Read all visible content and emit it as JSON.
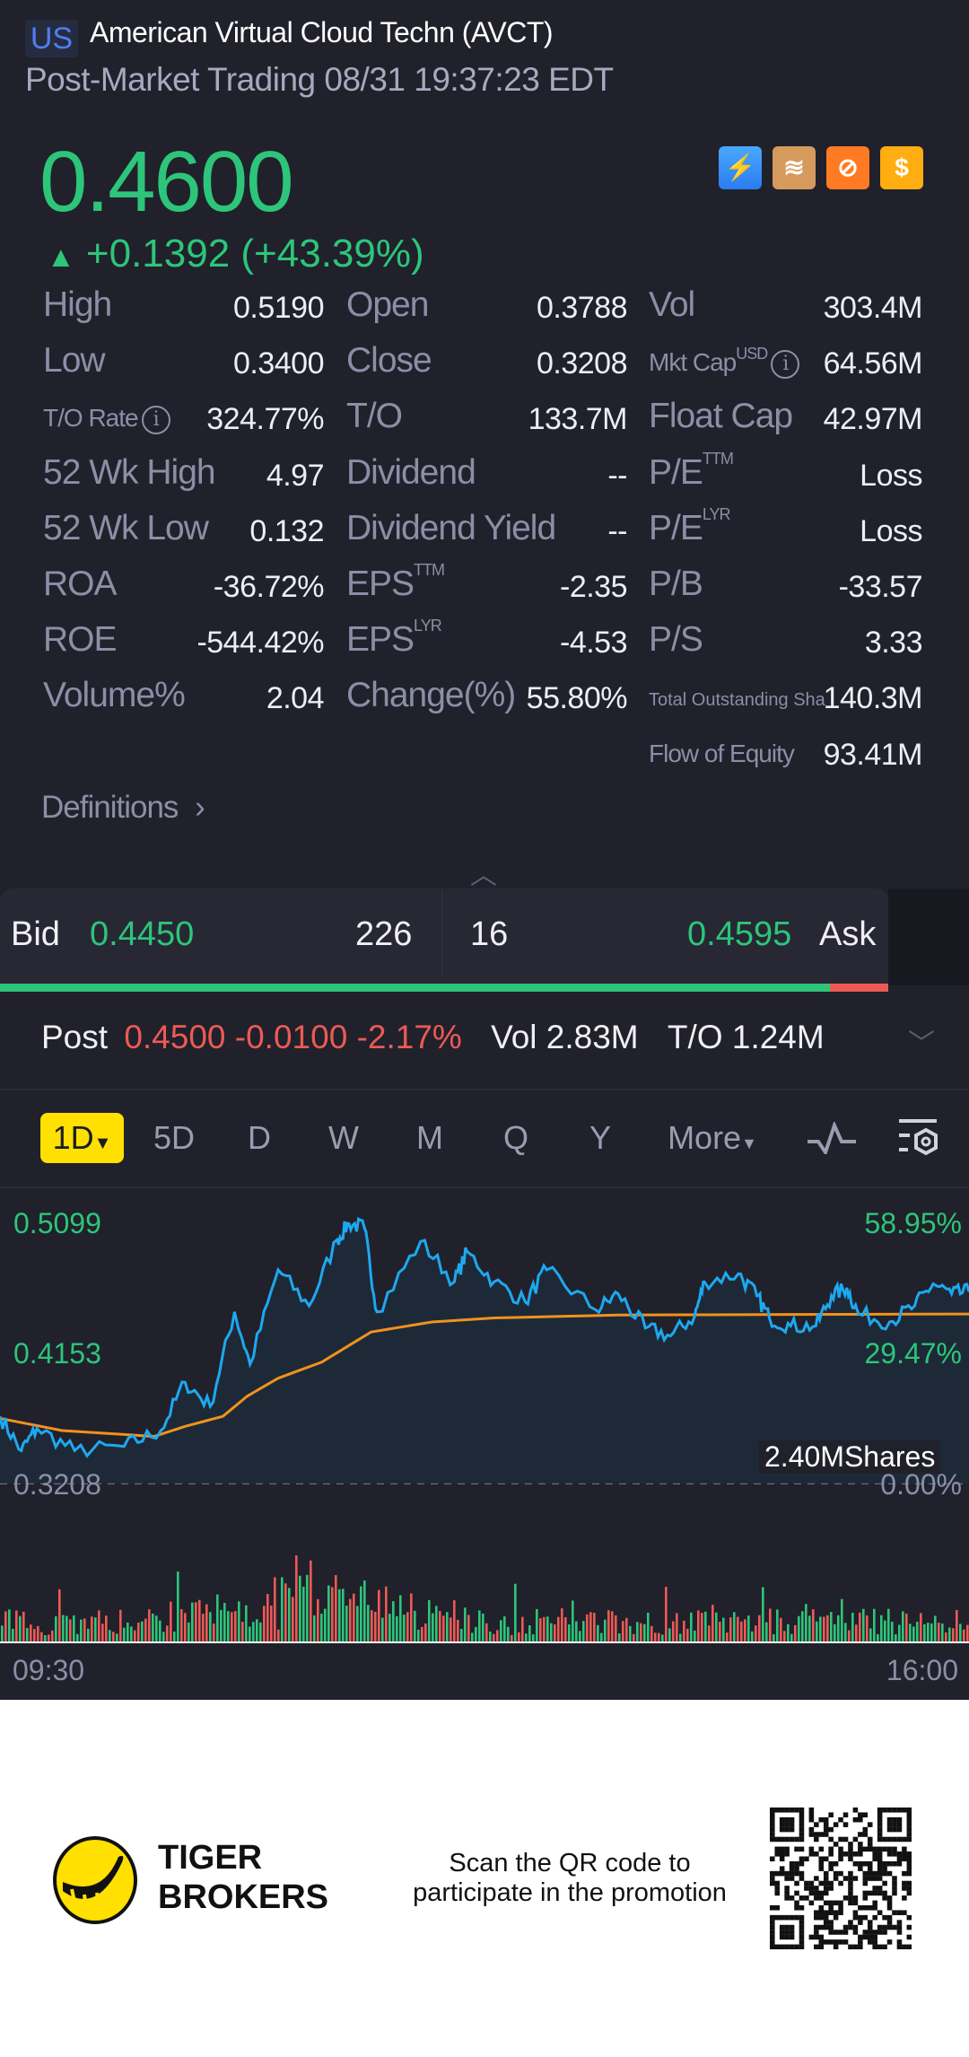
{
  "header": {
    "market": "US",
    "title": "American Virtual Cloud Techn (AVCT)",
    "subtitle": "Post-Market Trading 08/31 19:37:23 EDT"
  },
  "quote": {
    "price": "0.4600",
    "change": "+0.1392 (+43.39%)",
    "arrow": "▲"
  },
  "badges": [
    {
      "icon": "lightning-level1-icon",
      "text": "⚡"
    },
    {
      "icon": "layers-a-icon",
      "text": "≋"
    },
    {
      "icon": "no-short-icon",
      "text": "⊘"
    },
    {
      "icon": "dollar-icon",
      "text": "$"
    }
  ],
  "stats": [
    [
      {
        "label": "High",
        "value": "0.5190"
      },
      {
        "label": "Open",
        "value": "0.3788"
      },
      {
        "label": "Vol",
        "value": "303.4M"
      }
    ],
    [
      {
        "label": "Low",
        "value": "0.3400"
      },
      {
        "label": "Close",
        "value": "0.3208"
      },
      {
        "label": "Mkt Cap",
        "sup": "USD",
        "value": "64.56M"
      }
    ],
    [
      {
        "label": "T/O Rate",
        "value": "324.77%"
      },
      {
        "label": "T/O",
        "value": "133.7M"
      },
      {
        "label": "Float Cap",
        "value": "42.97M"
      }
    ],
    [
      {
        "label": "52 Wk High",
        "value": "4.97"
      },
      {
        "label": "Dividend",
        "value": "--"
      },
      {
        "label": "P/E",
        "sup": "TTM",
        "value": "Loss"
      }
    ],
    [
      {
        "label": "52 Wk Low",
        "value": "0.132"
      },
      {
        "label": "Dividend Yield",
        "value": "--"
      },
      {
        "label": "P/E",
        "sup": "LYR",
        "value": "Loss"
      }
    ],
    [
      {
        "label": "ROA",
        "value": "-36.72%"
      },
      {
        "label": "EPS",
        "sup": "TTM",
        "value": "-2.35"
      },
      {
        "label": "P/B",
        "value": "-33.57"
      }
    ],
    [
      {
        "label": "ROE",
        "value": "-544.42%"
      },
      {
        "label": "EPS",
        "sup": "LYR",
        "value": "-4.53"
      },
      {
        "label": "P/S",
        "value": "3.33"
      }
    ],
    [
      {
        "label": "Volume%",
        "value": "2.04"
      },
      {
        "label": "Change(%)",
        "value": "55.80%"
      },
      {
        "label": "Total Outstanding Sha",
        "value": "140.3M"
      }
    ],
    [
      null,
      null,
      {
        "label": "Flow of Equity",
        "value": "93.41M"
      }
    ]
  ],
  "definitions": "Definitions",
  "bidask": {
    "bid_label": "Bid",
    "bid_price": "0.4450",
    "bid_size": "226",
    "ask_size": "16",
    "ask_price": "0.4595",
    "ask_label": "Ask",
    "bid_ratio": 0.934
  },
  "post": {
    "label": "Post",
    "price": "0.4500",
    "change": "-0.0100",
    "pct": "-2.17%",
    "vol_label": "Vol",
    "vol": "2.83M",
    "to_label": "T/O",
    "to": "1.24M"
  },
  "timeframes": [
    "1D",
    "5D",
    "D",
    "W",
    "M",
    "Q",
    "Y",
    "More"
  ],
  "chart_data": {
    "type": "line",
    "title": "AVCT intraday 1D",
    "y_labels_left": [
      "0.5099",
      "0.4153",
      "0.3208"
    ],
    "y_labels_right": [
      "58.95%",
      "29.47%",
      "0.00%"
    ],
    "ylim": [
      0.3208,
      0.5099
    ],
    "x_labels": [
      "09:30",
      "16:00"
    ],
    "volume_label": "2.40MShares",
    "series": [
      {
        "name": "price",
        "color": "#1ea8f0",
        "x": [
          0,
          0.022,
          0.038,
          0.077,
          0.128,
          0.166,
          0.191,
          0.217,
          0.242,
          0.258,
          0.287,
          0.319,
          0.348,
          0.36,
          0.376,
          0.389,
          0.434,
          0.469,
          0.482,
          0.51,
          0.542,
          0.564,
          0.615,
          0.638,
          0.666,
          0.692,
          0.717,
          0.727,
          0.762,
          0.781,
          0.794,
          0.816,
          0.842,
          0.858,
          0.874,
          0.886,
          0.918,
          0.944,
          0.963,
          0.982,
          1.0
        ],
        "values": [
          0.3696,
          0.3447,
          0.3608,
          0.3447,
          0.3477,
          0.3593,
          0.3944,
          0.3769,
          0.4455,
          0.4075,
          0.4761,
          0.4499,
          0.498,
          0.5097,
          0.5068,
          0.4455,
          0.4966,
          0.4674,
          0.4893,
          0.4674,
          0.4528,
          0.4761,
          0.4469,
          0.4586,
          0.4338,
          0.428,
          0.4426,
          0.4674,
          0.4732,
          0.4572,
          0.4411,
          0.4353,
          0.4353,
          0.4572,
          0.463,
          0.444,
          0.4382,
          0.4499,
          0.4659,
          0.4586,
          0.4601
        ]
      },
      {
        "name": "average",
        "color": "#f0921e",
        "x": [
          0,
          0.064,
          0.159,
          0.191,
          0.23,
          0.255,
          0.287,
          0.332,
          0.383,
          0.446,
          0.51,
          0.638,
          1.0
        ],
        "values": [
          0.3681,
          0.3593,
          0.355,
          0.3623,
          0.3696,
          0.3842,
          0.3973,
          0.409,
          0.4309,
          0.4382,
          0.4411,
          0.4432,
          0.444
        ]
      }
    ]
  },
  "footer": {
    "brand_line1": "TIGER",
    "brand_line2": "BROKERS",
    "promo_line1": "Scan the QR code to",
    "promo_line2": "participate in the promotion"
  },
  "colors": {
    "up": "#2dc57a",
    "down": "#ec5a55",
    "accent": "#ffe000",
    "bg": "#20212b"
  }
}
